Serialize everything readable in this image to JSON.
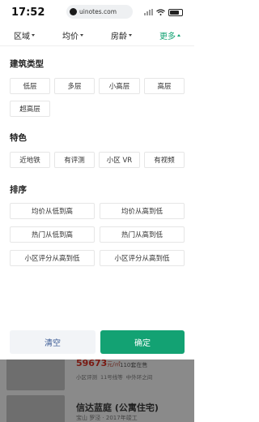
{
  "status_bar": {
    "time": "17:52",
    "url": "uinotes.com"
  },
  "filters": [
    {
      "label": "区域",
      "active": false
    },
    {
      "label": "均价",
      "active": false
    },
    {
      "label": "房龄",
      "active": false
    },
    {
      "label": "更多",
      "active": true
    }
  ],
  "sections": {
    "building_type": {
      "title": "建筑类型",
      "options": [
        "低层",
        "多层",
        "小高层",
        "高层",
        "超高层"
      ]
    },
    "features": {
      "title": "特色",
      "options": [
        "近地铁",
        "有评测",
        "小区 VR",
        "有视频"
      ]
    },
    "sort": {
      "title": "排序",
      "options": [
        "均价从低到高",
        "均价从高到低",
        "热门从低到高",
        "热门从高到低",
        "小区评分从高到低",
        "小区评分从高到低"
      ]
    }
  },
  "footer": {
    "clear_label": "清空",
    "confirm_label": "确定"
  },
  "background_listings": {
    "price": "59673",
    "price_unit": "元/㎡",
    "price_note": "110套在售",
    "tags": [
      "小区评测",
      "11号线等",
      "中外环之间"
    ],
    "name": "信达蓝庭 (公寓住宅)",
    "sub": "宝山 罗泾 · 2017年竣工"
  },
  "colors": {
    "accent": "#13a273",
    "clear_text": "#3a5a94"
  }
}
